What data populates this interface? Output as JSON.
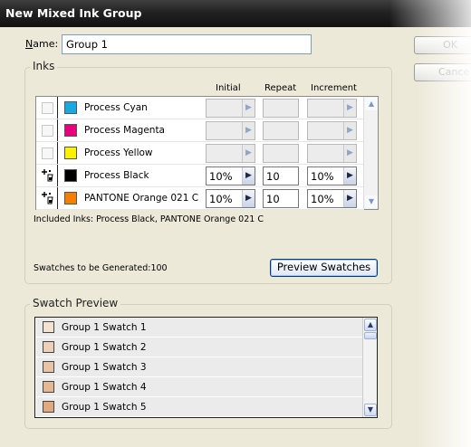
{
  "window": {
    "title": "New Mixed Ink Group"
  },
  "name_field": {
    "label": "Name:",
    "label_accel": "N",
    "label_rest": "ame:",
    "value": "Group 1"
  },
  "buttons": {
    "ok": "OK",
    "cancel": "Cance",
    "preview": "Preview Swatches"
  },
  "inks": {
    "group_label": "Inks",
    "columns": [
      "Initial",
      "Repeat",
      "Increment"
    ],
    "rows": [
      {
        "name": "Process Cyan",
        "color": "#1aa8e0",
        "included": false,
        "initial": "",
        "repeat": "",
        "increment": ""
      },
      {
        "name": "Process Magenta",
        "color": "#e6007e",
        "included": false,
        "initial": "",
        "repeat": "",
        "increment": ""
      },
      {
        "name": "Process Yellow",
        "color": "#fff200",
        "included": false,
        "initial": "",
        "repeat": "",
        "increment": ""
      },
      {
        "name": "Process Black",
        "color": "#000000",
        "included": true,
        "initial": "10%",
        "repeat": "10",
        "increment": "10%"
      },
      {
        "name": "PANTONE Orange 021 C",
        "color": "#f77f00",
        "included": true,
        "initial": "10%",
        "repeat": "10",
        "increment": "10%"
      }
    ],
    "included_text": "Included Inks: Process Black, PANTONE Orange 021 C",
    "to_generate_text": "Swatches to be Generated:100"
  },
  "swatch_preview": {
    "group_label": "Swatch Preview",
    "items": [
      {
        "name": "Group 1 Swatch 1",
        "color": "#f3e2d2"
      },
      {
        "name": "Group 1 Swatch 2",
        "color": "#eecfb8"
      },
      {
        "name": "Group 1 Swatch 3",
        "color": "#e9c3a5"
      },
      {
        "name": "Group 1 Swatch 4",
        "color": "#e5b794"
      },
      {
        "name": "Group 1 Swatch 5",
        "color": "#e0aa80"
      }
    ]
  }
}
